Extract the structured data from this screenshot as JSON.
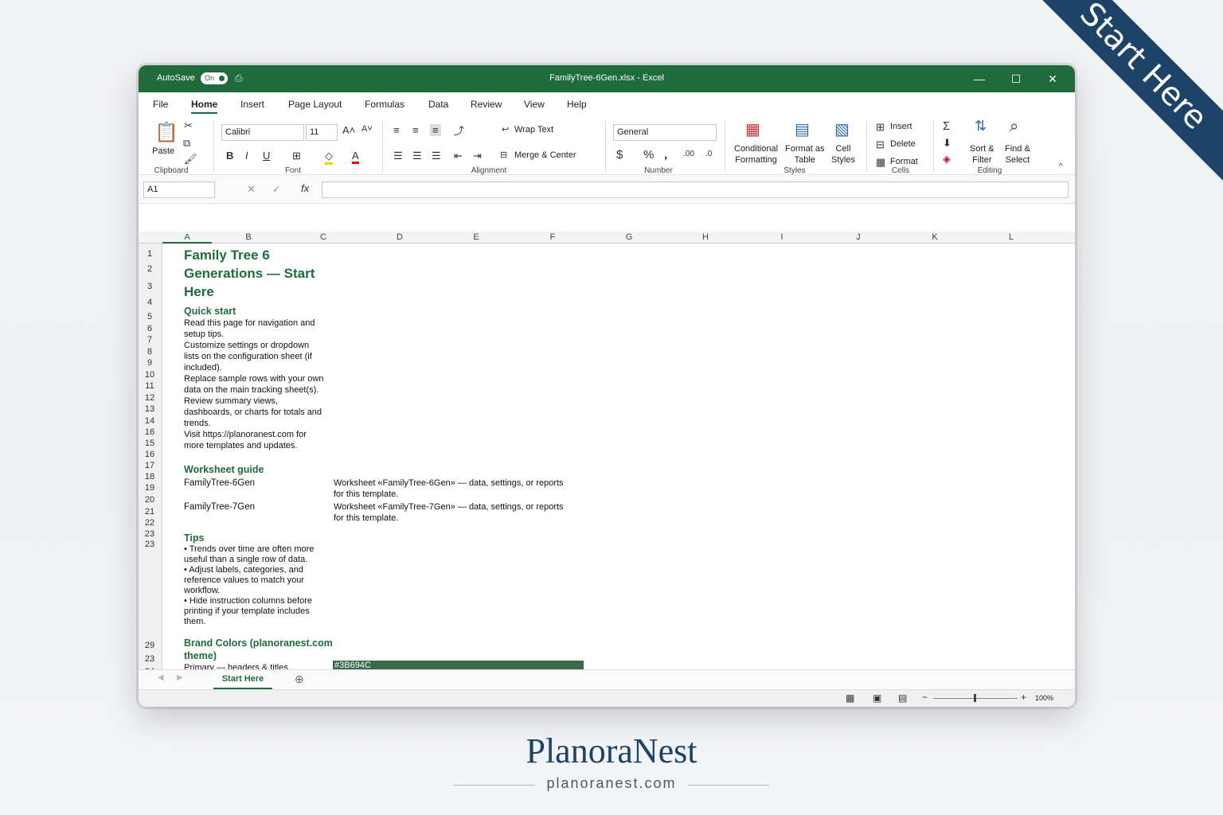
{
  "window": {
    "autosave_label": "AutoSave",
    "toggle": "On",
    "title": "FamilyTree-6Gen.xlsx  -  Excel"
  },
  "menu": [
    "File",
    "Home",
    "Insert",
    "Page Layout",
    "Formulas",
    "Data",
    "Review",
    "View",
    "Help"
  ],
  "ribbon": {
    "paste": "Paste",
    "clipboard": "Clipboard",
    "font_name": "Calibri",
    "font_size": "11",
    "font": "Font",
    "wrap_text": "Wrap Text",
    "merge_center": "Merge & Center",
    "alignment": "Alignment",
    "number_format": "General",
    "number": "Number",
    "cond_fmt_1": "Conditional",
    "cond_fmt_2": "Formatting",
    "fmt_table_1": "Format as",
    "fmt_table_2": "Table",
    "cell_styles_1": "Cell",
    "cell_styles_2": "Styles",
    "styles": "Styles",
    "insert": "Insert",
    "delete": "Delete",
    "format": "Format",
    "cells": "Cells",
    "sort_1": "Sort &",
    "sort_2": "Filter",
    "find_1": "Find &",
    "find_2": "Select",
    "editing": "Editing"
  },
  "formula_bar": {
    "name_box": "A1",
    "fx": "fx",
    "value": ""
  },
  "columns": [
    "A",
    "B",
    "C",
    "D",
    "E",
    "F",
    "G",
    "H",
    "I",
    "J",
    "K",
    "L"
  ],
  "rows": [
    "1",
    "2",
    "3",
    "4",
    "5",
    "6",
    "7",
    "8",
    "9",
    "10",
    "11",
    "12",
    "13",
    "14",
    "16",
    "15",
    "16",
    "17",
    "18",
    "19",
    "20",
    "21",
    "22",
    "23",
    "23",
    "29",
    "23",
    "24"
  ],
  "sheet": {
    "title_1": "Family Tree 6",
    "title_2": "Generations — Start",
    "title_3": "Here",
    "quick_start": "Quick start",
    "qs": [
      "Read this page for navigation and",
      "setup tips.",
      "Customize settings or dropdown",
      "lists on the configuration sheet (if",
      "included).",
      "Replace sample rows with your own",
      "data on the main tracking sheet(s).",
      "Review summary views,",
      "dashboards, or charts for totals and",
      "trends.",
      "Visit https://planoranest.com for",
      "more templates and updates."
    ],
    "worksheet_guide": "Worksheet guide",
    "ws1_name": "FamilyTree-6Gen",
    "ws1_desc_1": "Worksheet «FamilyTree-6Gen» — data, settings, or reports",
    "ws1_desc_2": "for this template.",
    "ws2_name": "FamilyTree-7Gen",
    "ws2_desc_1": "Worksheet «FamilyTree-7Gen» — data, settings, or reports",
    "ws2_desc_2": "for this template.",
    "tips": "Tips",
    "tips_lines": [
      "• Trends over time are often more",
      "useful than a single row of data.",
      "• Adjust labels, categories, and",
      "reference values to match your",
      "workflow.",
      "• Hide instruction columns before",
      "printing if your template includes",
      "them."
    ],
    "brand_1": "Brand Colors (planoranest.com",
    "brand_2": "theme)",
    "primary_label": "Primary — headers & titles",
    "primary_hex": "#3B694C"
  },
  "sheet_tab": "Start Here",
  "zoom": "100%",
  "banner": "Start Here",
  "brand": {
    "logo": "PlanoraNest",
    "url": "planoranest.com",
    "color": "#1d4369",
    "accent": "#3b694c"
  }
}
